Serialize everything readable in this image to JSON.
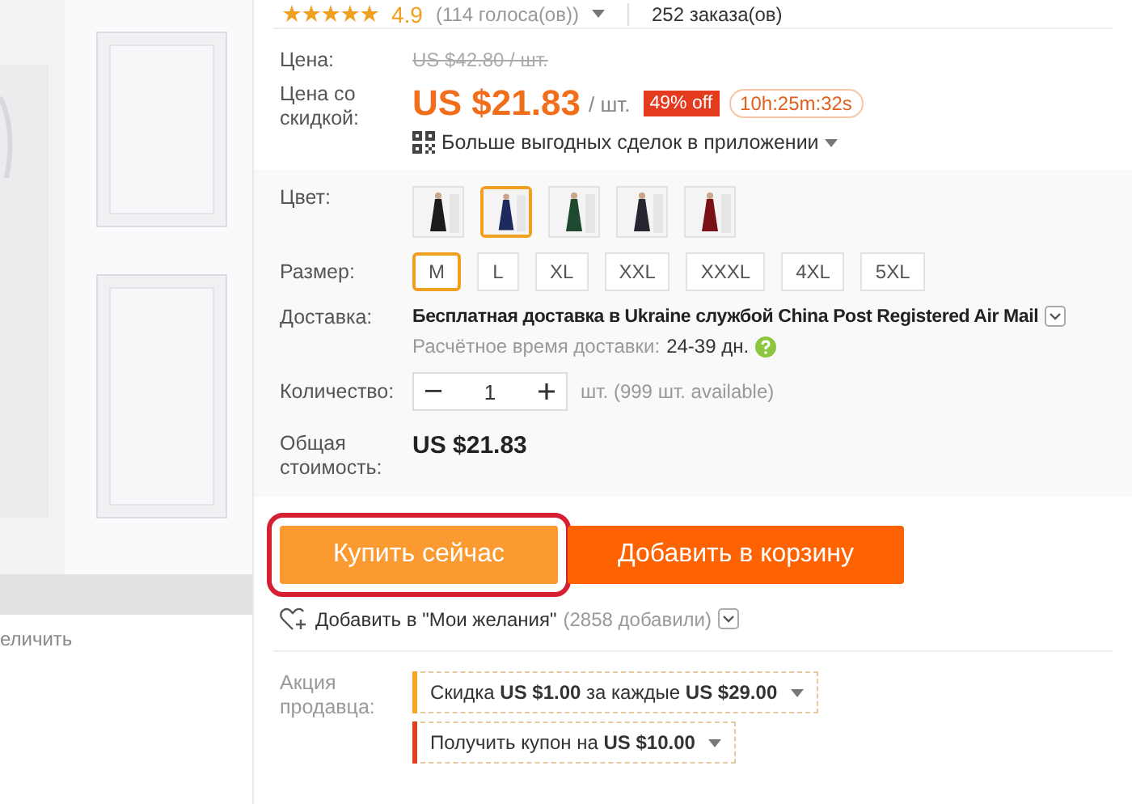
{
  "rating": {
    "stars": 5,
    "score": "4.9",
    "votes": "(114 голоса(ов))",
    "orders": "252 заказа(ов)"
  },
  "image_caption": "еличить",
  "price": {
    "label": "Цена:",
    "original": "US $42.80 / шт.",
    "discount_label": "Цена со скидкой:",
    "current": "US $21.83",
    "unit": "/ шт.",
    "off_badge": "49% off",
    "timer": "10h:25m:32s",
    "app_deals": "Больше выгодных сделок в приложении"
  },
  "options": {
    "color_label": "Цвет:",
    "colors": [
      {
        "color": "#1c1c1c",
        "selected": false
      },
      {
        "color": "#1f2a5c",
        "selected": true
      },
      {
        "color": "#1d4a2e",
        "selected": false
      },
      {
        "color": "#262630",
        "selected": false
      },
      {
        "color": "#7a1018",
        "selected": false
      }
    ],
    "size_label": "Размер:",
    "sizes": [
      {
        "label": "M",
        "selected": true
      },
      {
        "label": "L",
        "selected": false
      },
      {
        "label": "XL",
        "selected": false
      },
      {
        "label": "XXL",
        "selected": false
      },
      {
        "label": "XXXL",
        "selected": false
      },
      {
        "label": "4XL",
        "selected": false
      },
      {
        "label": "5XL",
        "selected": false
      }
    ],
    "delivery_label": "Доставка:",
    "delivery": "Бесплатная доставка в Ukraine службой China Post Registered Air Mail",
    "eta_label": "Расчётное время доставки:",
    "eta": "24-39 дн.",
    "quantity_label": "Количество:",
    "quantity": "1",
    "stock": "шт. (999 шт. available)",
    "total_label": "Общая стоимость:",
    "total": "US $21.83"
  },
  "buttons": [
    {
      "label": "Купить сейчас",
      "kind": "buy",
      "highlighted": true
    },
    {
      "label": "Добавить в корзину",
      "kind": "cart",
      "highlighted": false
    }
  ],
  "wishlist": {
    "label": "Добавить в \"Мои желания\"",
    "count": "(2858 добавили)"
  },
  "promo": {
    "label": "Акция продавца:",
    "items": [
      {
        "text": "Скидка **US $1.00** за каждые **US $29.00**",
        "color": "#f5a623"
      },
      {
        "text": "Получить купон на **US $10.00**",
        "color": "#e0401c"
      }
    ]
  }
}
